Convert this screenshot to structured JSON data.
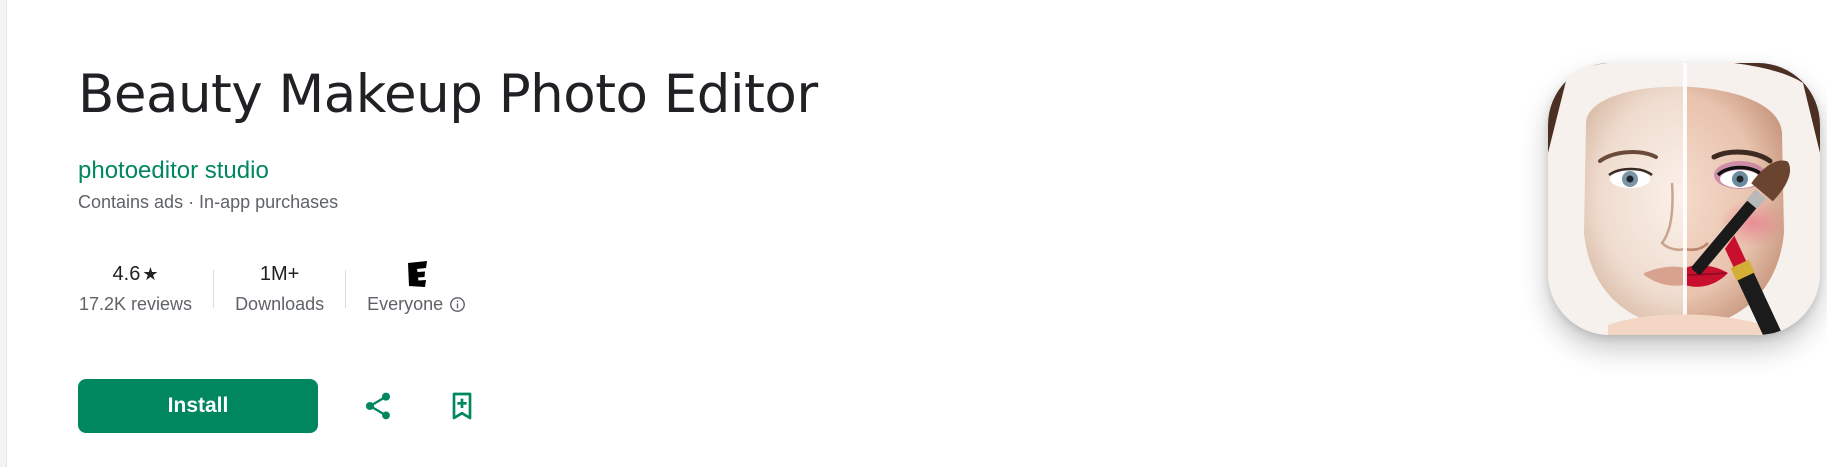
{
  "app": {
    "title": "Beauty Makeup Photo Editor",
    "developer": "photoeditor studio",
    "meta": "Contains ads · In-app purchases"
  },
  "stats": {
    "rating": "4.6",
    "rating_icon": "star-icon",
    "reviews": "17.2K reviews",
    "downloads_value": "1M+",
    "downloads_label": "Downloads",
    "content_rating_icon": "esrb-everyone-icon",
    "content_rating_label": "Everyone",
    "content_rating_info_icon": "info-icon"
  },
  "actions": {
    "install_label": "Install",
    "share_icon": "share-icon",
    "wishlist_icon": "bookmark-add-icon"
  },
  "app_icon": {
    "name": "app-icon",
    "description_icon": "face-makeup-split-icon"
  },
  "colors": {
    "accent": "#01875f",
    "title_text": "#202124",
    "secondary_text": "#5f6368",
    "divider": "#dadce0"
  }
}
